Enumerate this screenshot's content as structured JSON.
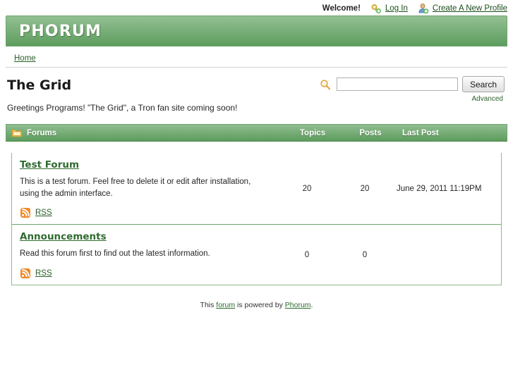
{
  "topbar": {
    "welcome": "Welcome!",
    "login": {
      "label": "Log In",
      "icon": "key-icon"
    },
    "register": {
      "label": "Create A New Profile",
      "icon": "user-add-icon"
    }
  },
  "header": {
    "logo": "PHORUM",
    "brand_green_light": "#93c093",
    "brand_green_dark": "#5d9c5d"
  },
  "breadcrumb": {
    "home": "Home"
  },
  "page": {
    "title": "The Grid",
    "tagline": "Greetings Programs! ”The Grid\", a Tron fan site coming soon!"
  },
  "search": {
    "icon": "search-icon",
    "value": "",
    "placeholder": "",
    "button_label": "Search",
    "advanced_label": "Advanced"
  },
  "forums_table": {
    "header": {
      "icon": "folder-icon",
      "forums": "Forums",
      "topics": "Topics",
      "posts": "Posts",
      "last_post": "Last Post"
    },
    "rows": [
      {
        "name": "Test Forum",
        "description": "This is a test forum. Feel free to delete it or edit after installation, using the admin interface.",
        "rss_label": "RSS",
        "rss_icon": "rss-icon",
        "topics": "20",
        "posts": "20",
        "last_post": "June 29, 2011 11:19PM"
      },
      {
        "name": "Announcements",
        "description": "Read this forum first to find out the latest information.",
        "rss_label": "RSS",
        "rss_icon": "rss-icon",
        "topics": "0",
        "posts": "0",
        "last_post": ""
      }
    ]
  },
  "footer": {
    "prefix": "This ",
    "forum_link": "forum",
    "middle": " is powered by ",
    "phorum_link": "Phorum",
    "suffix": "."
  }
}
